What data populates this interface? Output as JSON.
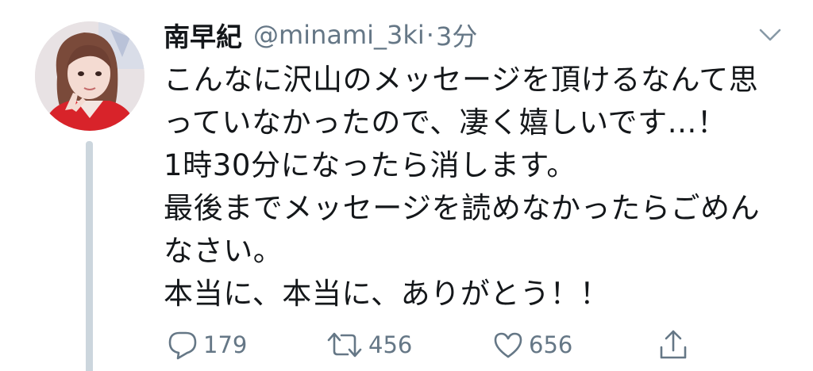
{
  "tweet": {
    "user": {
      "display_name": "南早紀",
      "handle": "@minami_3ki",
      "separator": "·",
      "time": "3分"
    },
    "body_lines": [
      "こんなに沢山のメッセージを頂けるなんて思",
      "っていなかったので、凄く嬉しいです...！",
      "1時30分になったら消します。",
      "最後までメッセージを読めなかったらごめん",
      "なさい。",
      "本当に、本当に、ありがとう！！"
    ],
    "actions": {
      "reply_count": "179",
      "retweet_count": "456",
      "like_count": "656"
    },
    "icons": {
      "reply": "reply-icon",
      "retweet": "retweet-icon",
      "like": "heart-icon",
      "share": "share-icon",
      "more": "chevron-down-icon"
    },
    "colors": {
      "text": "#14171a",
      "secondary": "#657786",
      "thread_line": "#ccd6dd"
    }
  }
}
